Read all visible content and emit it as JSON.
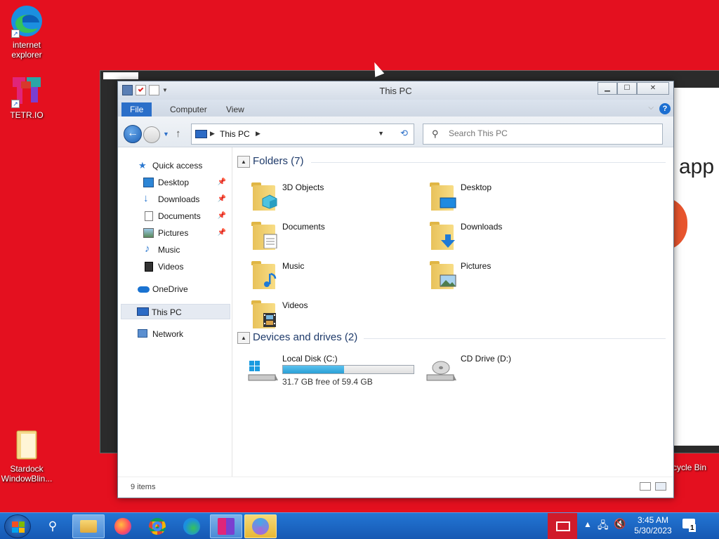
{
  "desktop": {
    "icons": [
      {
        "label": "internet explorer",
        "icon": "edge-icon"
      },
      {
        "label": "TETR.IO",
        "icon": "tetrio-icon"
      },
      {
        "label": "Stardock WindowBlin...",
        "icon": "folder-icon"
      }
    ],
    "recycle_bin_label": "cycle Bin",
    "background_window_text": "app"
  },
  "window": {
    "title": "This PC",
    "buttons": {
      "minimize": "▁",
      "maximize": "☐",
      "close": "✕"
    },
    "ribbon_tabs": [
      "File",
      "Computer",
      "View"
    ],
    "help_label": "?",
    "address": {
      "location": "This PC"
    },
    "search": {
      "placeholder": "Search This PC"
    },
    "sidebar": {
      "quick_access": "Quick access",
      "items": [
        {
          "label": "Desktop",
          "icon": "desktop-icon",
          "pinned": true
        },
        {
          "label": "Downloads",
          "icon": "download-icon",
          "pinned": true
        },
        {
          "label": "Documents",
          "icon": "documents-icon",
          "pinned": true
        },
        {
          "label": "Pictures",
          "icon": "pictures-icon",
          "pinned": true
        },
        {
          "label": "Music",
          "icon": "music-icon",
          "pinned": false
        },
        {
          "label": "Videos",
          "icon": "videos-icon",
          "pinned": false
        }
      ],
      "onedrive": "OneDrive",
      "this_pc": "This PC",
      "network": "Network"
    },
    "folders_group": {
      "title": "Folders (7)",
      "items": [
        {
          "label": "3D Objects",
          "icon": "3d-objects-icon"
        },
        {
          "label": "Desktop",
          "icon": "desktop-folder-icon"
        },
        {
          "label": "Documents",
          "icon": "documents-folder-icon"
        },
        {
          "label": "Downloads",
          "icon": "downloads-folder-icon"
        },
        {
          "label": "Music",
          "icon": "music-folder-icon"
        },
        {
          "label": "Pictures",
          "icon": "pictures-folder-icon"
        },
        {
          "label": "Videos",
          "icon": "videos-folder-icon"
        }
      ]
    },
    "drives_group": {
      "title": "Devices and drives (2)",
      "drives": [
        {
          "label": "Local Disk (C:)",
          "free_text": "31.7 GB free of 59.4 GB",
          "used_fraction": 0.466,
          "icon": "hard-drive-icon"
        },
        {
          "label": "CD Drive (D:)",
          "icon": "cd-drive-icon"
        }
      ]
    },
    "status": {
      "item_count": "9 items"
    }
  },
  "taskbar": {
    "apps": [
      "file-explorer-icon",
      "firefox-icon",
      "chrome-icon",
      "edge-icon",
      "tetrio-icon",
      "photos-icon"
    ],
    "clock_time": "3:45 AM",
    "clock_date": "5/30/2023",
    "notification_count": "1"
  },
  "colors": {
    "desktop_bg": "#e4101f",
    "accent": "#2b6fc9",
    "taskbar": "#1658b3"
  }
}
